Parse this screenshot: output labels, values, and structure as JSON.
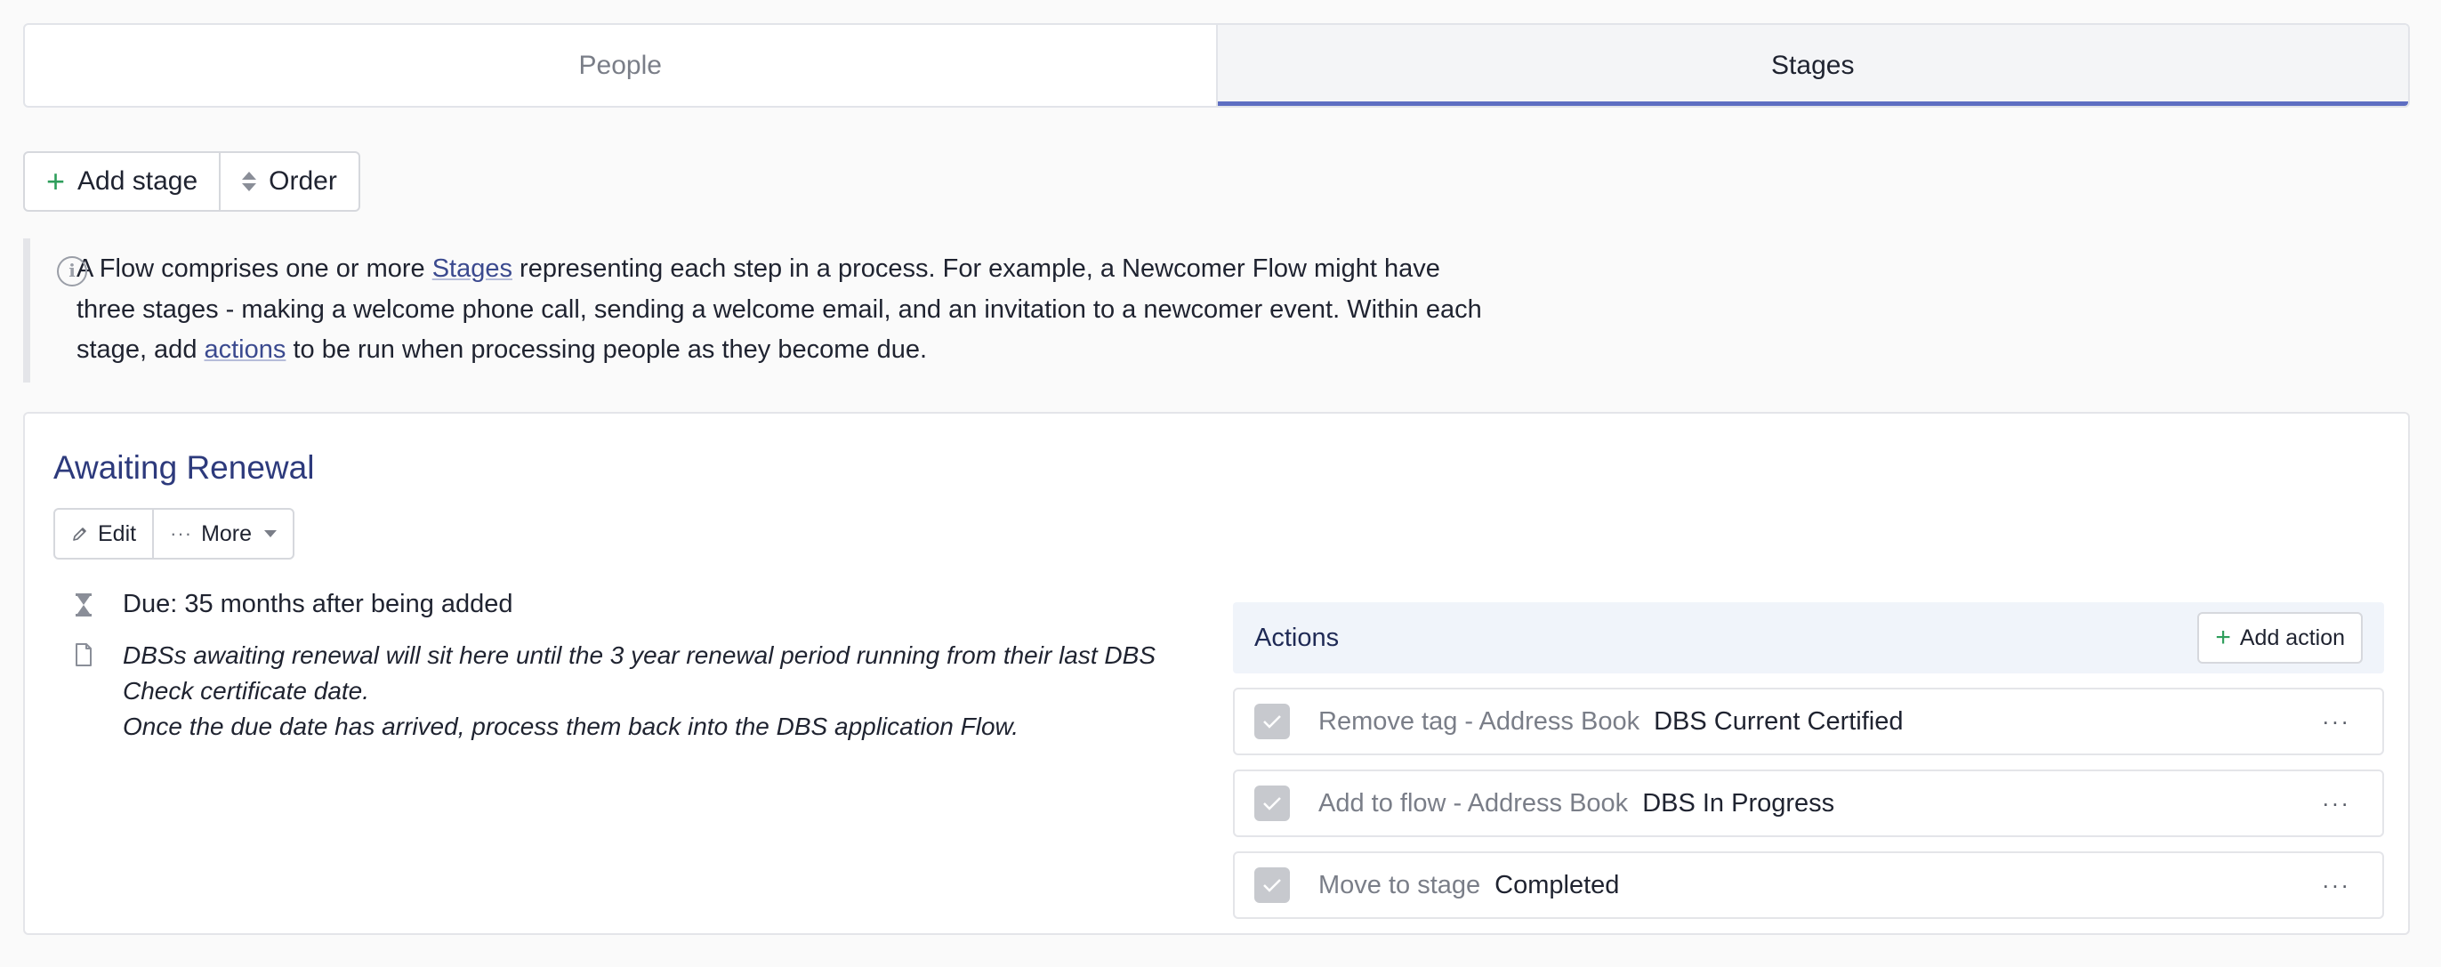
{
  "tabs": [
    {
      "label": "People",
      "active": false
    },
    {
      "label": "Stages",
      "active": true
    }
  ],
  "toolbar": {
    "add_stage": "Add stage",
    "order": "Order"
  },
  "info": {
    "part1": "A Flow comprises one or more ",
    "link1": "Stages",
    "part2": " representing each step in a process. For example, a Newcomer Flow might have three stages - making a welcome phone call, sending a welcome email, and an invitation to a newcomer event. Within each stage, add ",
    "link2": "actions",
    "part3": " to be run when processing people as they become due."
  },
  "stage": {
    "title": "Awaiting Renewal",
    "edit_label": "Edit",
    "more_label": "More",
    "due": "Due: 35 months after being added",
    "description_line1": "DBSs awaiting renewal will sit here until the 3 year renewal period running from their last DBS Check certificate date.",
    "description_line2": "Once the due date has arrived, process them back into the DBS application Flow."
  },
  "actions": {
    "title": "Actions",
    "add_label": "Add action",
    "items": [
      {
        "type": "Remove tag - Address Book",
        "value": "DBS Current Certified"
      },
      {
        "type": "Add to flow - Address Book",
        "value": "DBS In Progress"
      },
      {
        "type": "Move to stage",
        "value": "Completed"
      }
    ]
  },
  "colors": {
    "accent": "#5e6ec2",
    "link": "#3b4a8f",
    "add_green": "#2e9e5b",
    "stage_title": "#2d3a7c"
  }
}
